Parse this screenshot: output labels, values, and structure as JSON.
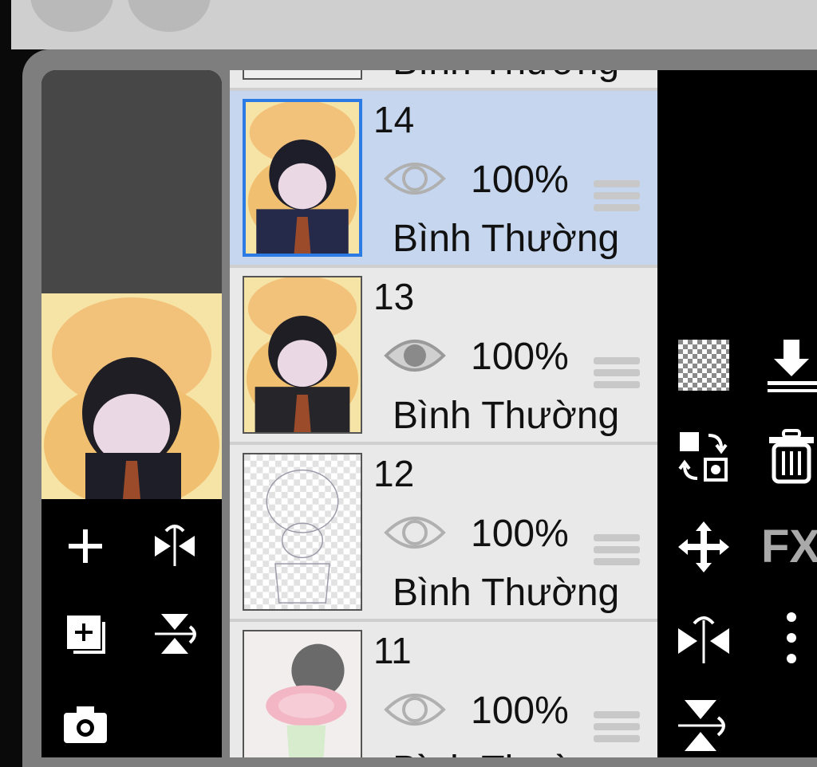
{
  "layers": [
    {
      "number": "",
      "opacity": "",
      "blend": "Bình Thường",
      "visible": true
    },
    {
      "number": "14",
      "opacity": "100%",
      "blend": "Bình Thường",
      "visible": false,
      "selected": true
    },
    {
      "number": "13",
      "opacity": "100%",
      "blend": "Bình Thường",
      "visible": true
    },
    {
      "number": "12",
      "opacity": "100%",
      "blend": "Bình Thường",
      "visible": false
    },
    {
      "number": "11",
      "opacity": "100%",
      "blend": "Bình Thường",
      "visible": false
    }
  ],
  "right_tools": {
    "fx_label": "FX"
  },
  "colors": {
    "selected_row": "#c6d6ee",
    "selected_border": "#2c7be5",
    "row_bg": "#e9e9e9",
    "panel_bg": "#7e7e7e"
  }
}
